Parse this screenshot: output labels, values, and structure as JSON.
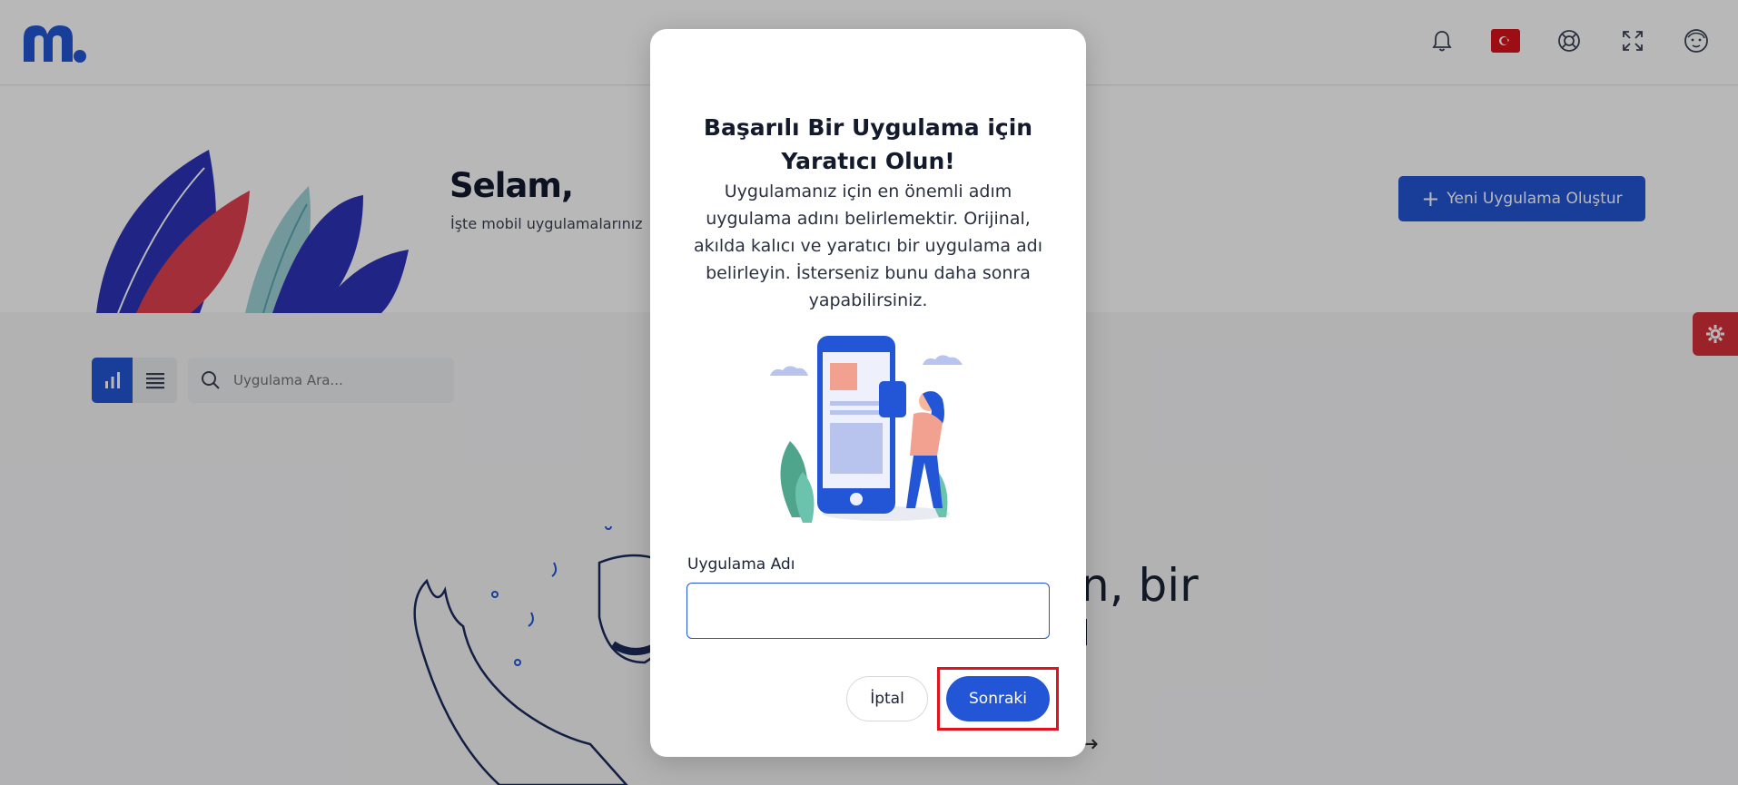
{
  "header": {
    "logo_alt": "m.",
    "icons": [
      "bell-icon",
      "turkey-flag-icon",
      "help-icon",
      "fullscreen-icon",
      "profile-icon"
    ]
  },
  "banner": {
    "greeting": "Selam,",
    "subtitle": "İşte mobil uygulamalarınız",
    "new_app_label": "Yeni Uygulama Oluştur"
  },
  "toolbar": {
    "search_placeholder": "Uygulama Ara..."
  },
  "background_text": {
    "title_fragment": "n, bir",
    "line2_fragment": "l"
  },
  "modal": {
    "title_line1": "Başarılı Bir Uygulama için",
    "title_line2": "Yaratıcı Olun!",
    "description": "Uygulamanız için en önemli adım uygulama adını belirlemektir. Orijinal, akılda kalıcı ve yaratıcı bir uygulama adı belirleyin. İsterseniz bunu daha sonra yapabilirsiniz.",
    "field_label": "Uygulama Adı",
    "field_value": "",
    "cancel_label": "İptal",
    "next_label": "Sonraki"
  },
  "colors": {
    "primary": "#2356d6",
    "highlight": "#e3121c",
    "settings_tab": "#d8303a"
  }
}
